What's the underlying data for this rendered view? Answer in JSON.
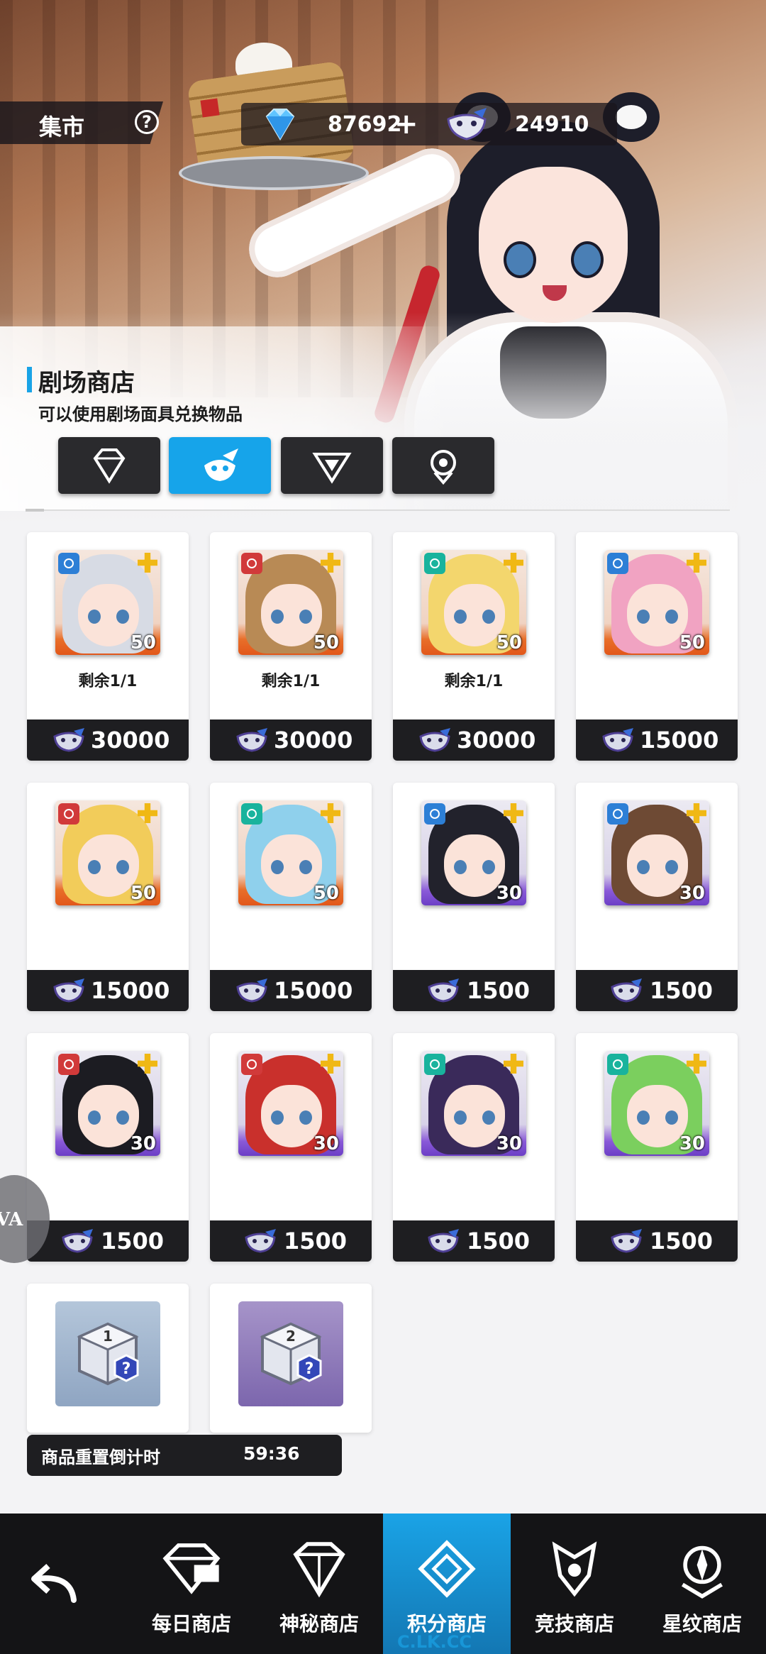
{
  "header": {
    "title": "集市",
    "help_icon": "?",
    "gems": "87692",
    "gem_plus": "+",
    "masks": "24910"
  },
  "shop": {
    "title": "剧场商店",
    "description": "可以使用剧场面具兑换物品",
    "tabs": [
      {
        "icon": "diamond-badge-icon",
        "active": false
      },
      {
        "icon": "mask-wing-icon",
        "active": true
      },
      {
        "icon": "arrow-badge-icon",
        "active": false
      },
      {
        "icon": "orb-badge-icon",
        "active": false
      }
    ]
  },
  "items": [
    {
      "level": "50",
      "remain": "剩余1/1",
      "price": "30000",
      "element": "ice",
      "rarity": "orange"
    },
    {
      "level": "50",
      "remain": "剩余1/1",
      "price": "30000",
      "element": "fire",
      "rarity": "orange"
    },
    {
      "level": "50",
      "remain": "剩余1/1",
      "price": "30000",
      "element": "water",
      "rarity": "orange"
    },
    {
      "level": "50",
      "remain": "",
      "price": "15000",
      "element": "ice",
      "rarity": "orange"
    },
    {
      "level": "50",
      "remain": "",
      "price": "15000",
      "element": "fire",
      "rarity": "orange"
    },
    {
      "level": "50",
      "remain": "",
      "price": "15000",
      "element": "water",
      "rarity": "orange"
    },
    {
      "level": "30",
      "remain": "",
      "price": "1500",
      "element": "ice",
      "rarity": "purple"
    },
    {
      "level": "30",
      "remain": "",
      "price": "1500",
      "element": "ice",
      "rarity": "purple"
    },
    {
      "level": "30",
      "remain": "",
      "price": "1500",
      "element": "fire",
      "rarity": "purple"
    },
    {
      "level": "30",
      "remain": "",
      "price": "1500",
      "element": "fire",
      "rarity": "purple"
    },
    {
      "level": "30",
      "remain": "",
      "price": "1500",
      "element": "water",
      "rarity": "purple"
    },
    {
      "level": "30",
      "remain": "",
      "price": "1500",
      "element": "water",
      "rarity": "purple"
    },
    {
      "type": "box",
      "box_number": "1"
    },
    {
      "type": "box",
      "box_number": "2"
    }
  ],
  "timer": {
    "label": "商品重置倒计时",
    "value": "59:36"
  },
  "float_button": "VA",
  "nav": [
    {
      "label": "每日商店",
      "icon": "daily-shop-icon",
      "active": false
    },
    {
      "label": "神秘商店",
      "icon": "mystery-shop-icon",
      "active": false
    },
    {
      "label": "积分商店",
      "icon": "points-shop-icon",
      "active": true
    },
    {
      "label": "竞技商店",
      "icon": "arena-shop-icon",
      "active": false
    },
    {
      "label": "星纹商店",
      "icon": "star-shop-icon",
      "active": false
    }
  ],
  "watermark": "C.LK.CC",
  "colors": {
    "accent": "#16a4ea",
    "dark": "#1e1e21",
    "level_orange": "#e2571a",
    "level_purple": "#6c3fc6"
  }
}
